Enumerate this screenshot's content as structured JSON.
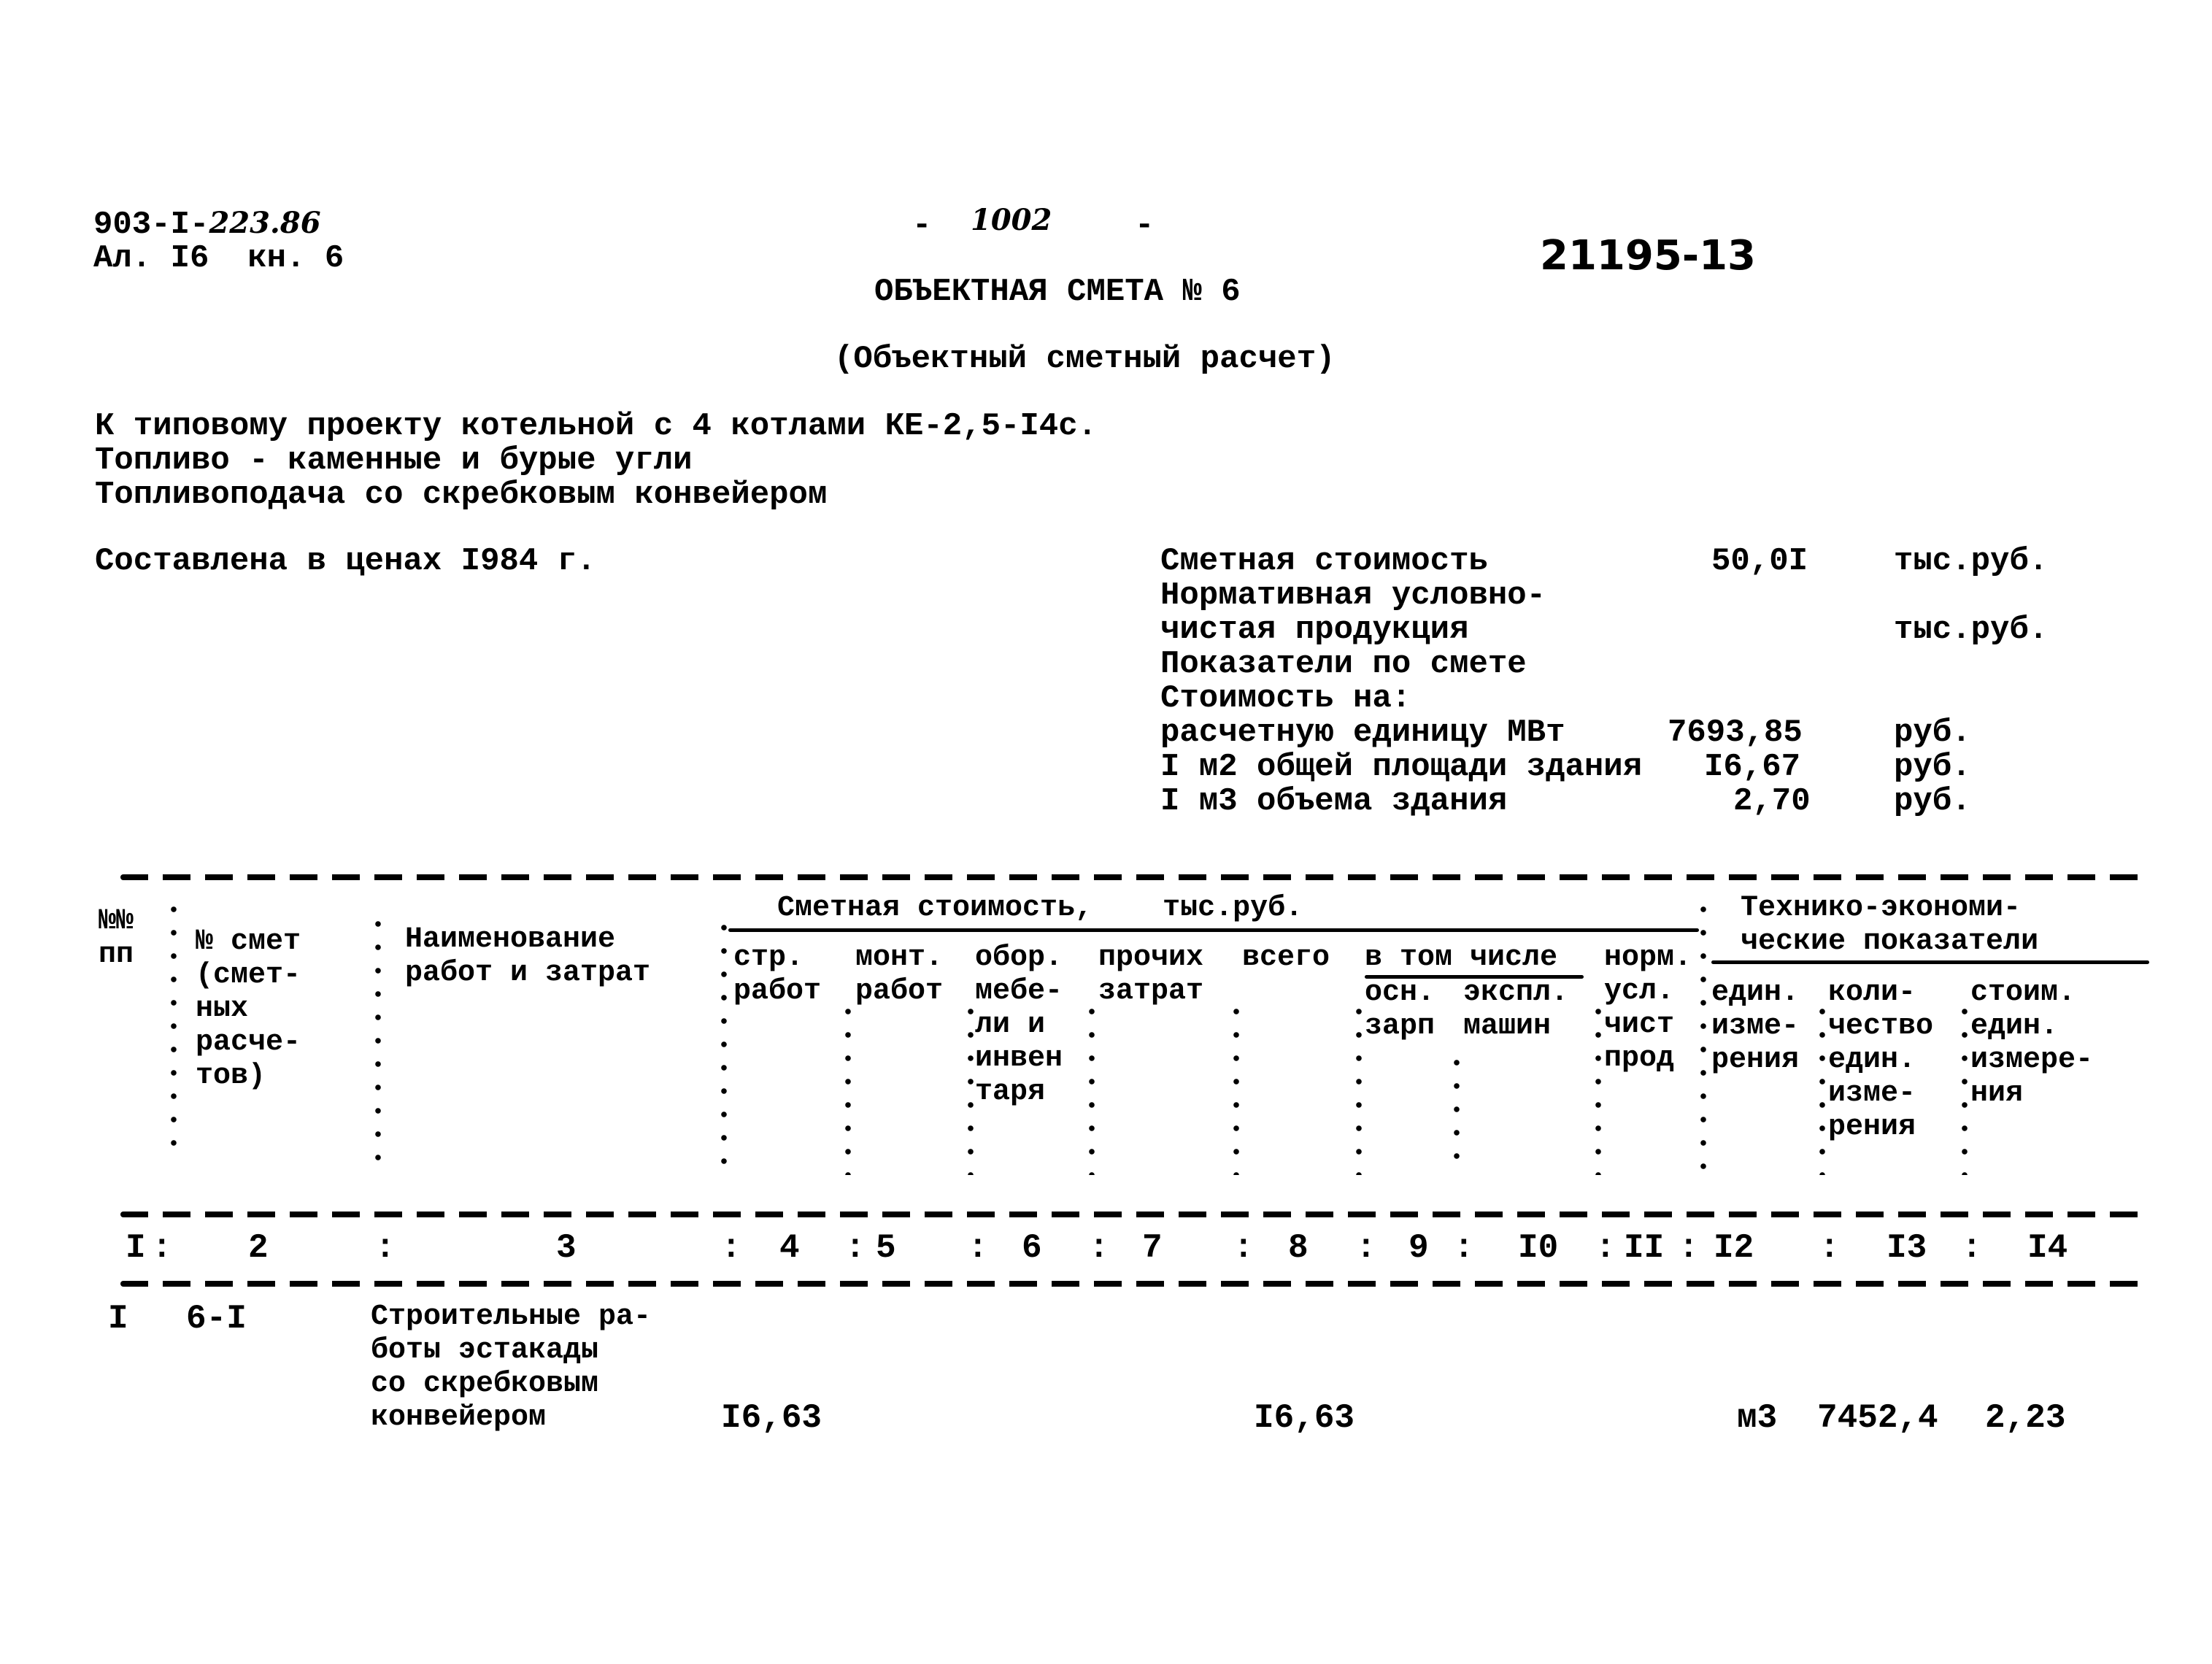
{
  "header": {
    "doc_code": "903-I-",
    "doc_code_handwritten": "223.86",
    "album_line": "Ал. I6  кн. 6",
    "page_number_handwritten": "1002",
    "page_dash_left": "-",
    "page_dash_right": "-",
    "stamp_number_handwritten": "21195-13",
    "title": "ОБЪЕКТНАЯ СМЕТА № 6",
    "subtitle": "(Объектный сметный расчет)"
  },
  "project": {
    "lines": [
      "К типовому проекту котельной с 4 котлами КЕ-2,5-I4с.",
      "Топливо - каменные и бурые угли",
      "Топливоподача со скребковым конвейером"
    ],
    "prices_note": "Составлена в ценах I984 г."
  },
  "summary": {
    "rows": [
      {
        "label": "Сметная стоимость",
        "value": "50,0I",
        "unit": "тыс.руб."
      },
      {
        "label": "Нормативная условно-",
        "value": "",
        "unit": ""
      },
      {
        "label": "чистая продукция",
        "value": "",
        "unit": "тыс.руб."
      },
      {
        "label": "Показатели по смете",
        "value": "",
        "unit": ""
      },
      {
        "label": "Стоимость на:",
        "value": "",
        "unit": ""
      },
      {
        "label": "расчетную единицу МВт",
        "value": "7693,85",
        "unit": "руб."
      },
      {
        "label": "I м2 общей площади здания",
        "value": "I6,67",
        "unit": "руб."
      },
      {
        "label": "I м3 объема здания",
        "value": "2,70",
        "unit": "руб."
      }
    ]
  },
  "table": {
    "headers": {
      "col1": "№№\nпп",
      "col2": "№ смет\n(смет-\nных\nрасче-\nтов)",
      "col3": "Наименование\nработ и затрат",
      "group_cost": "Сметная стоимость,    тыс.руб.",
      "col4": "стр.\nработ",
      "col5": "монт.\nработ",
      "col6": "обор.\nмебе-\nли и\nинвен\nтаря",
      "col7": "прочих\nзатрат",
      "col8": "всего",
      "group_incl": "в том числе",
      "col9": "осн.\nзарп",
      "col10": "экспл.\nмашин",
      "col11": "норм.\nусл.\nчист\nпрод",
      "group_tech": "Технико-экономи-\nческие показатели",
      "col12": "един.\nизме-\nрения",
      "col13": "коли-\nчество\nедин.\nизме-\nрения",
      "col14": "стоим.\nедин.\nизмере-\nния"
    },
    "column_numbers": [
      "I",
      "2",
      "3",
      "4",
      "5",
      "6",
      "7",
      "8",
      "9",
      "I0",
      "II",
      "I2",
      "I3",
      "I4"
    ],
    "rows": [
      {
        "num": "I",
        "estimate_no": "6-I",
        "name": "Строительные ра-\nботы эстакады\nсо скребковым\nконвейером",
        "construction_works": "I6,63",
        "installation_works": "",
        "equipment": "",
        "other_costs": "",
        "total": "I6,63",
        "base_salary": "",
        "machine_operation": "",
        "net_product": "",
        "unit": "м3",
        "quantity": "7452,4",
        "unit_cost": "2,23"
      }
    ]
  }
}
